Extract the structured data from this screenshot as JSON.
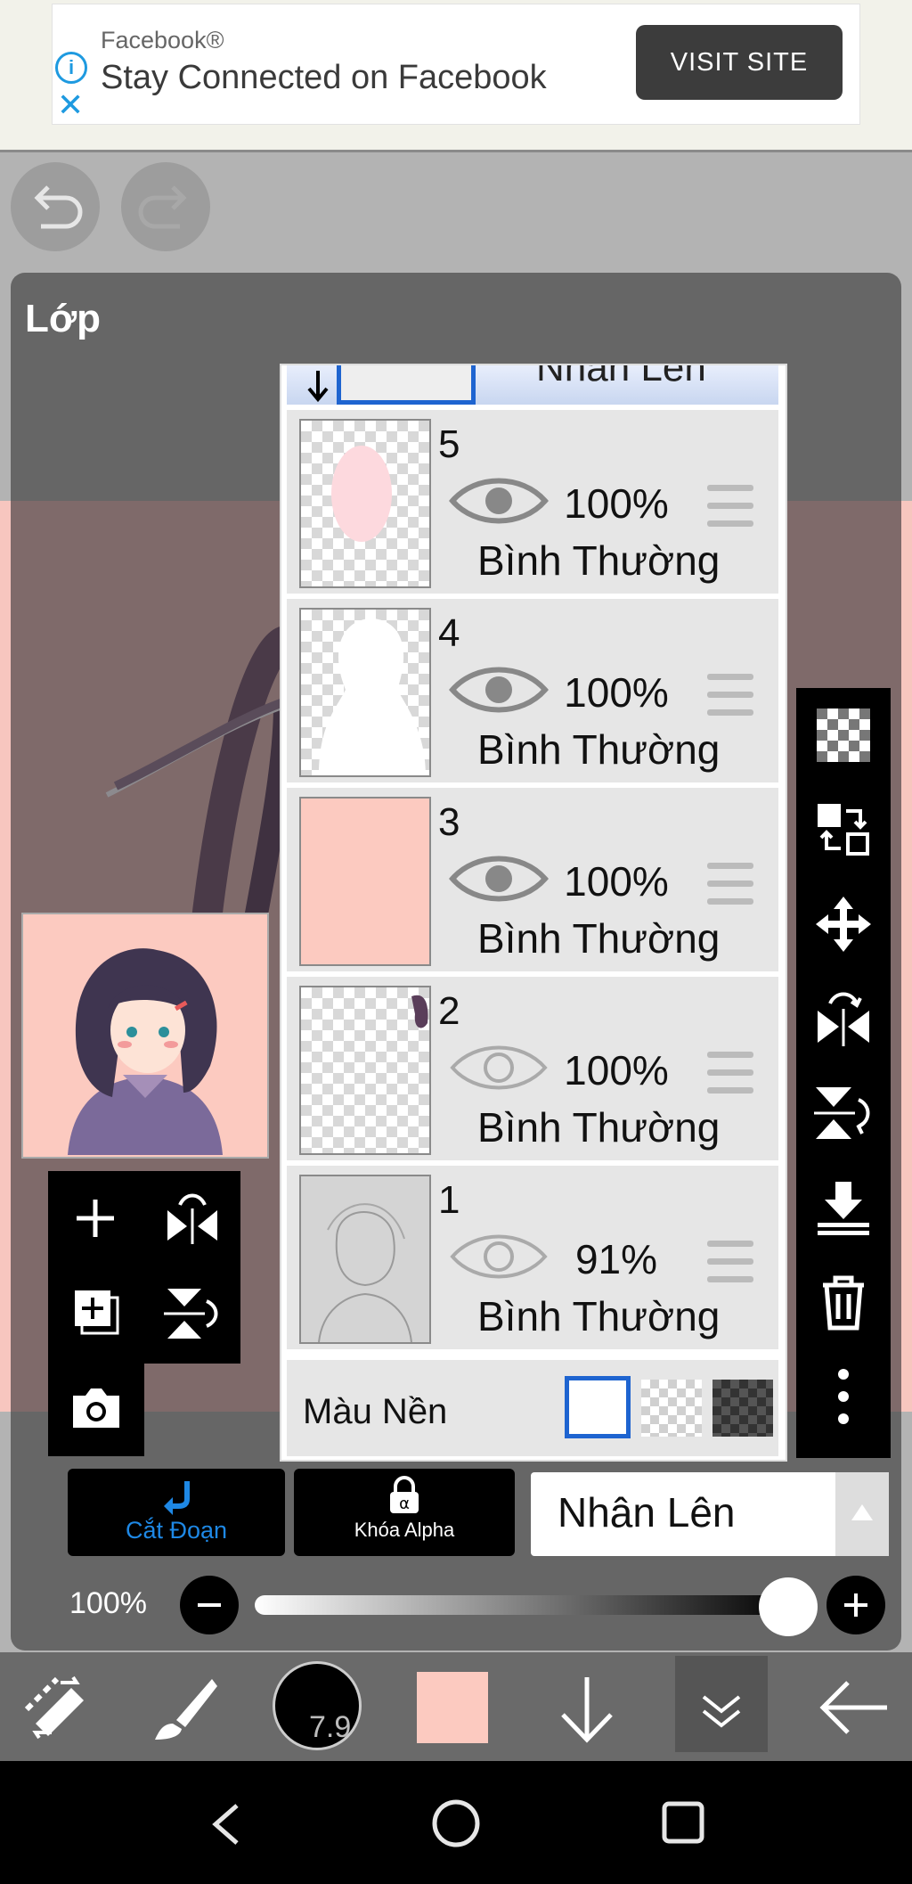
{
  "ad": {
    "brand": "Facebook®",
    "headline": "Stay Connected on Facebook",
    "button": "VISIT SITE"
  },
  "panel": {
    "title": "Lớp"
  },
  "layers": {
    "top_partial_label": "Nhân Lên",
    "items": [
      {
        "number": "5",
        "opacity": "100%",
        "blend": "Bình Thường",
        "visible": true
      },
      {
        "number": "4",
        "opacity": "100%",
        "blend": "Bình Thường",
        "visible": true
      },
      {
        "number": "3",
        "opacity": "100%",
        "blend": "Bình Thường",
        "visible": true
      },
      {
        "number": "2",
        "opacity": "100%",
        "blend": "Bình Thường",
        "visible": false
      },
      {
        "number": "1",
        "opacity": "91%",
        "blend": "Bình Thường",
        "visible": false
      }
    ],
    "background_label": "Màu Nền"
  },
  "modes": {
    "clip_label": "Cắt Đoạn",
    "alpha_lock_label": "Khóa Alpha",
    "blend_mode": "Nhân Lên"
  },
  "opacity": {
    "label": "100%",
    "value": 1.0
  },
  "toolbar": {
    "brush_size": "7.9",
    "color": "#fccac0"
  },
  "colors": {
    "accent": "#1e88e5",
    "canvas": "#fccac0",
    "panel": "#666666"
  }
}
